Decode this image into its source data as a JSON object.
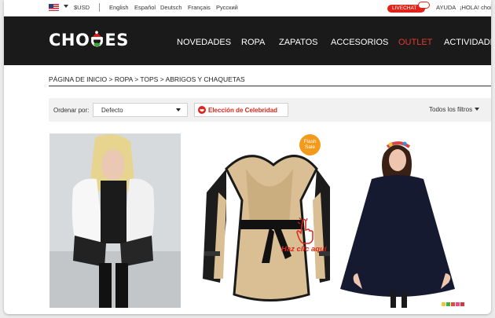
{
  "topbar": {
    "currency": "$USD",
    "languages": [
      "English",
      "Español",
      "Deutsch",
      "Français",
      "Русский"
    ],
    "livechat": "LIVECHAT",
    "help": "AYUDA",
    "greeting": "¡HOLA! choies"
  },
  "header": {
    "logo_left": "CHO",
    "logo_right": "ES",
    "nav": [
      "NOVEDADES",
      "ROPA",
      "ZAPATOS",
      "ACCESORIOS",
      "OUTLET",
      "ACTIVIDADES"
    ],
    "nav_highlight_color": "#e53a2c"
  },
  "breadcrumb": "PÁGINA DE INICIO > ROPA > TOPS > ABRIGOS Y CHAQUETAS",
  "filters": {
    "sort_label": "Ordenar por:",
    "sort_value": "Defecto",
    "celebrity_label": "Elección de Celebridad",
    "all_filters": "Todos los filtros",
    "cut_off": "C"
  },
  "products": [
    {
      "name": "faux-fur-jacket-photo"
    },
    {
      "name": "camel-wrap-coat-photo",
      "badge": [
        "Flash",
        "Sale"
      ],
      "overlay_text": "Haz clic aquí"
    },
    {
      "name": "navy-cape-coat-photo"
    }
  ],
  "colors": {
    "accent": "#e0241b",
    "header_bg": "#1a1a1a",
    "flash": "#f39a1a"
  }
}
